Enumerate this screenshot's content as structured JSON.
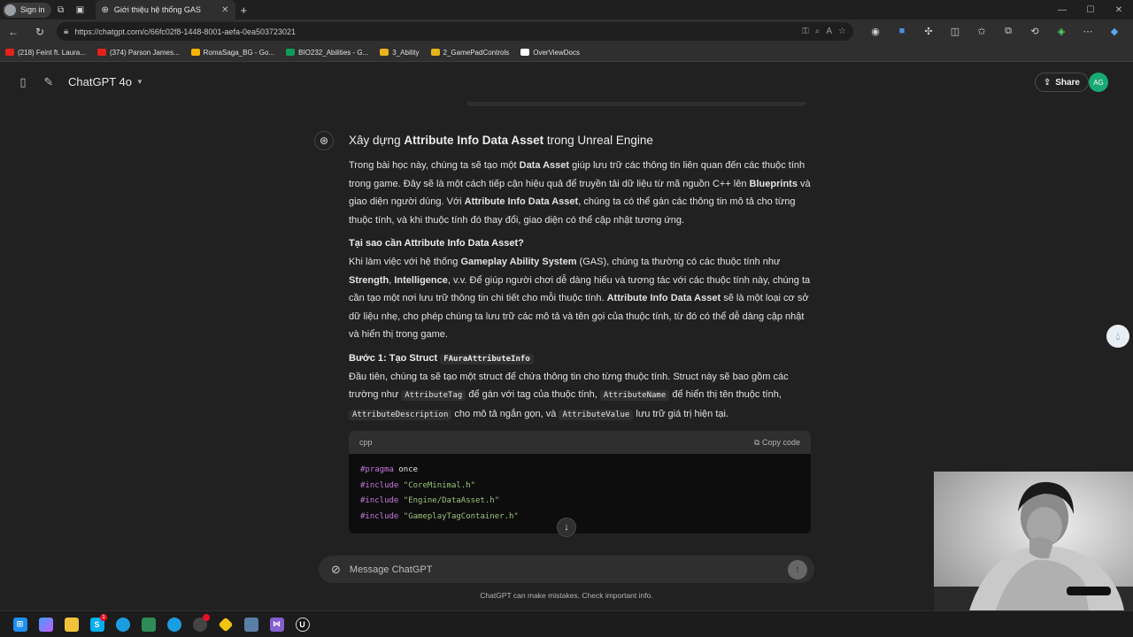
{
  "browser": {
    "signin_label": "Sign in",
    "tab_title": "Giới thiệu hệ thống GAS",
    "url": "https://chatgpt.com/c/66fc02f8-1448-8001-aefa-0ea503723021",
    "bookmarks": [
      {
        "label": "(218) Feint ft. Laura...",
        "color": "#e62117"
      },
      {
        "label": "(374) Parson James...",
        "color": "#e62117"
      },
      {
        "label": "RomaSaga_BG - Go...",
        "color": "#f4b400"
      },
      {
        "label": "BIO232_Abilities - G...",
        "color": "#0f9d58"
      },
      {
        "label": "3_Ability",
        "color": "#e8b21b"
      },
      {
        "label": "2_GamePadControls",
        "color": "#e8b21b"
      },
      {
        "label": "OverViewDocs",
        "color": "#ffffff"
      }
    ]
  },
  "app": {
    "model_label": "ChatGPT 4o",
    "share_label": "Share",
    "avatar_initials": "AG",
    "accent": "#19a974"
  },
  "message": {
    "title_pre": "Xây dựng ",
    "title_bold": "Attribute Info Data Asset",
    "title_post": " trong Unreal Engine",
    "p1": {
      "a": "Trong bài học này, chúng ta sẽ tạo một ",
      "b": "Data Asset",
      "c": " giúp lưu trữ các thông tin liên quan đến các thuộc tính trong game. Đây sẽ là một cách tiếp cận hiệu quả để truyền tải dữ liệu từ mã nguồn C++ lên ",
      "d": "Blueprints",
      "e": " và giao diện người dùng. Với ",
      "f": "Attribute Info Data Asset",
      "g": ", chúng ta có thể gán các thông tin mô tả cho từng thuộc tính, và khi thuộc tính đó thay đổi, giao diện có thể cập nhật tương ứng."
    },
    "h_why": "Tại sao cần Attribute Info Data Asset?",
    "p2": {
      "a": "Khi làm việc với hệ thống ",
      "b": "Gameplay Ability System",
      "c": " (GAS), chúng ta thường có các thuộc tính như ",
      "d": "Strength",
      "e": ", ",
      "f": "Intelligence",
      "g": ", v.v. Để giúp người chơi dễ dàng hiểu và tương tác với các thuộc tính này, chúng ta cần tạo một nơi lưu trữ thông tin chi tiết cho mỗi thuộc tính. ",
      "h": "Attribute Info Data Asset",
      "i": " sẽ là một loại cơ sở dữ liệu nhẹ, cho phép chúng ta lưu trữ các mô tả và tên gọi của thuộc tính, từ đó có thể dễ dàng cập nhật và hiển thị trong game."
    },
    "h_step1": "Bước 1: Tạo Struct ",
    "h_step1_code": "FAuraAttributeInfo",
    "p3": {
      "a": "Đầu tiên, chúng ta sẽ tạo một struct để chứa thông tin cho từng thuộc tính. Struct này sẽ bao gồm các trường như ",
      "b": "AttributeTag",
      "c": " để gán với tag của thuộc tính, ",
      "d": "AttributeName",
      "e": " để hiển thị tên thuộc tính, ",
      "f": "AttributeDescription",
      "g": " cho mô tả ngắn gọn, và ",
      "h": "AttributeValue",
      "i": " lưu trữ giá trị hiện tại."
    },
    "code": {
      "lang": "cpp",
      "copy_label": "Copy code",
      "lines": [
        {
          "kw": "#pragma",
          "rest": " once",
          "type": "plain"
        },
        {
          "kw": "#include",
          "rest": " \"CoreMinimal.h\"",
          "type": "str"
        },
        {
          "kw": "#include",
          "rest": " \"Engine/DataAsset.h\"",
          "type": "str"
        },
        {
          "kw": "#include",
          "rest": " \"GameplayTagContainer.h\"",
          "type": "str"
        }
      ]
    }
  },
  "composer": {
    "placeholder": "Message ChatGPT"
  },
  "disclaimer": "ChatGPT can make mistakes. Check important info."
}
